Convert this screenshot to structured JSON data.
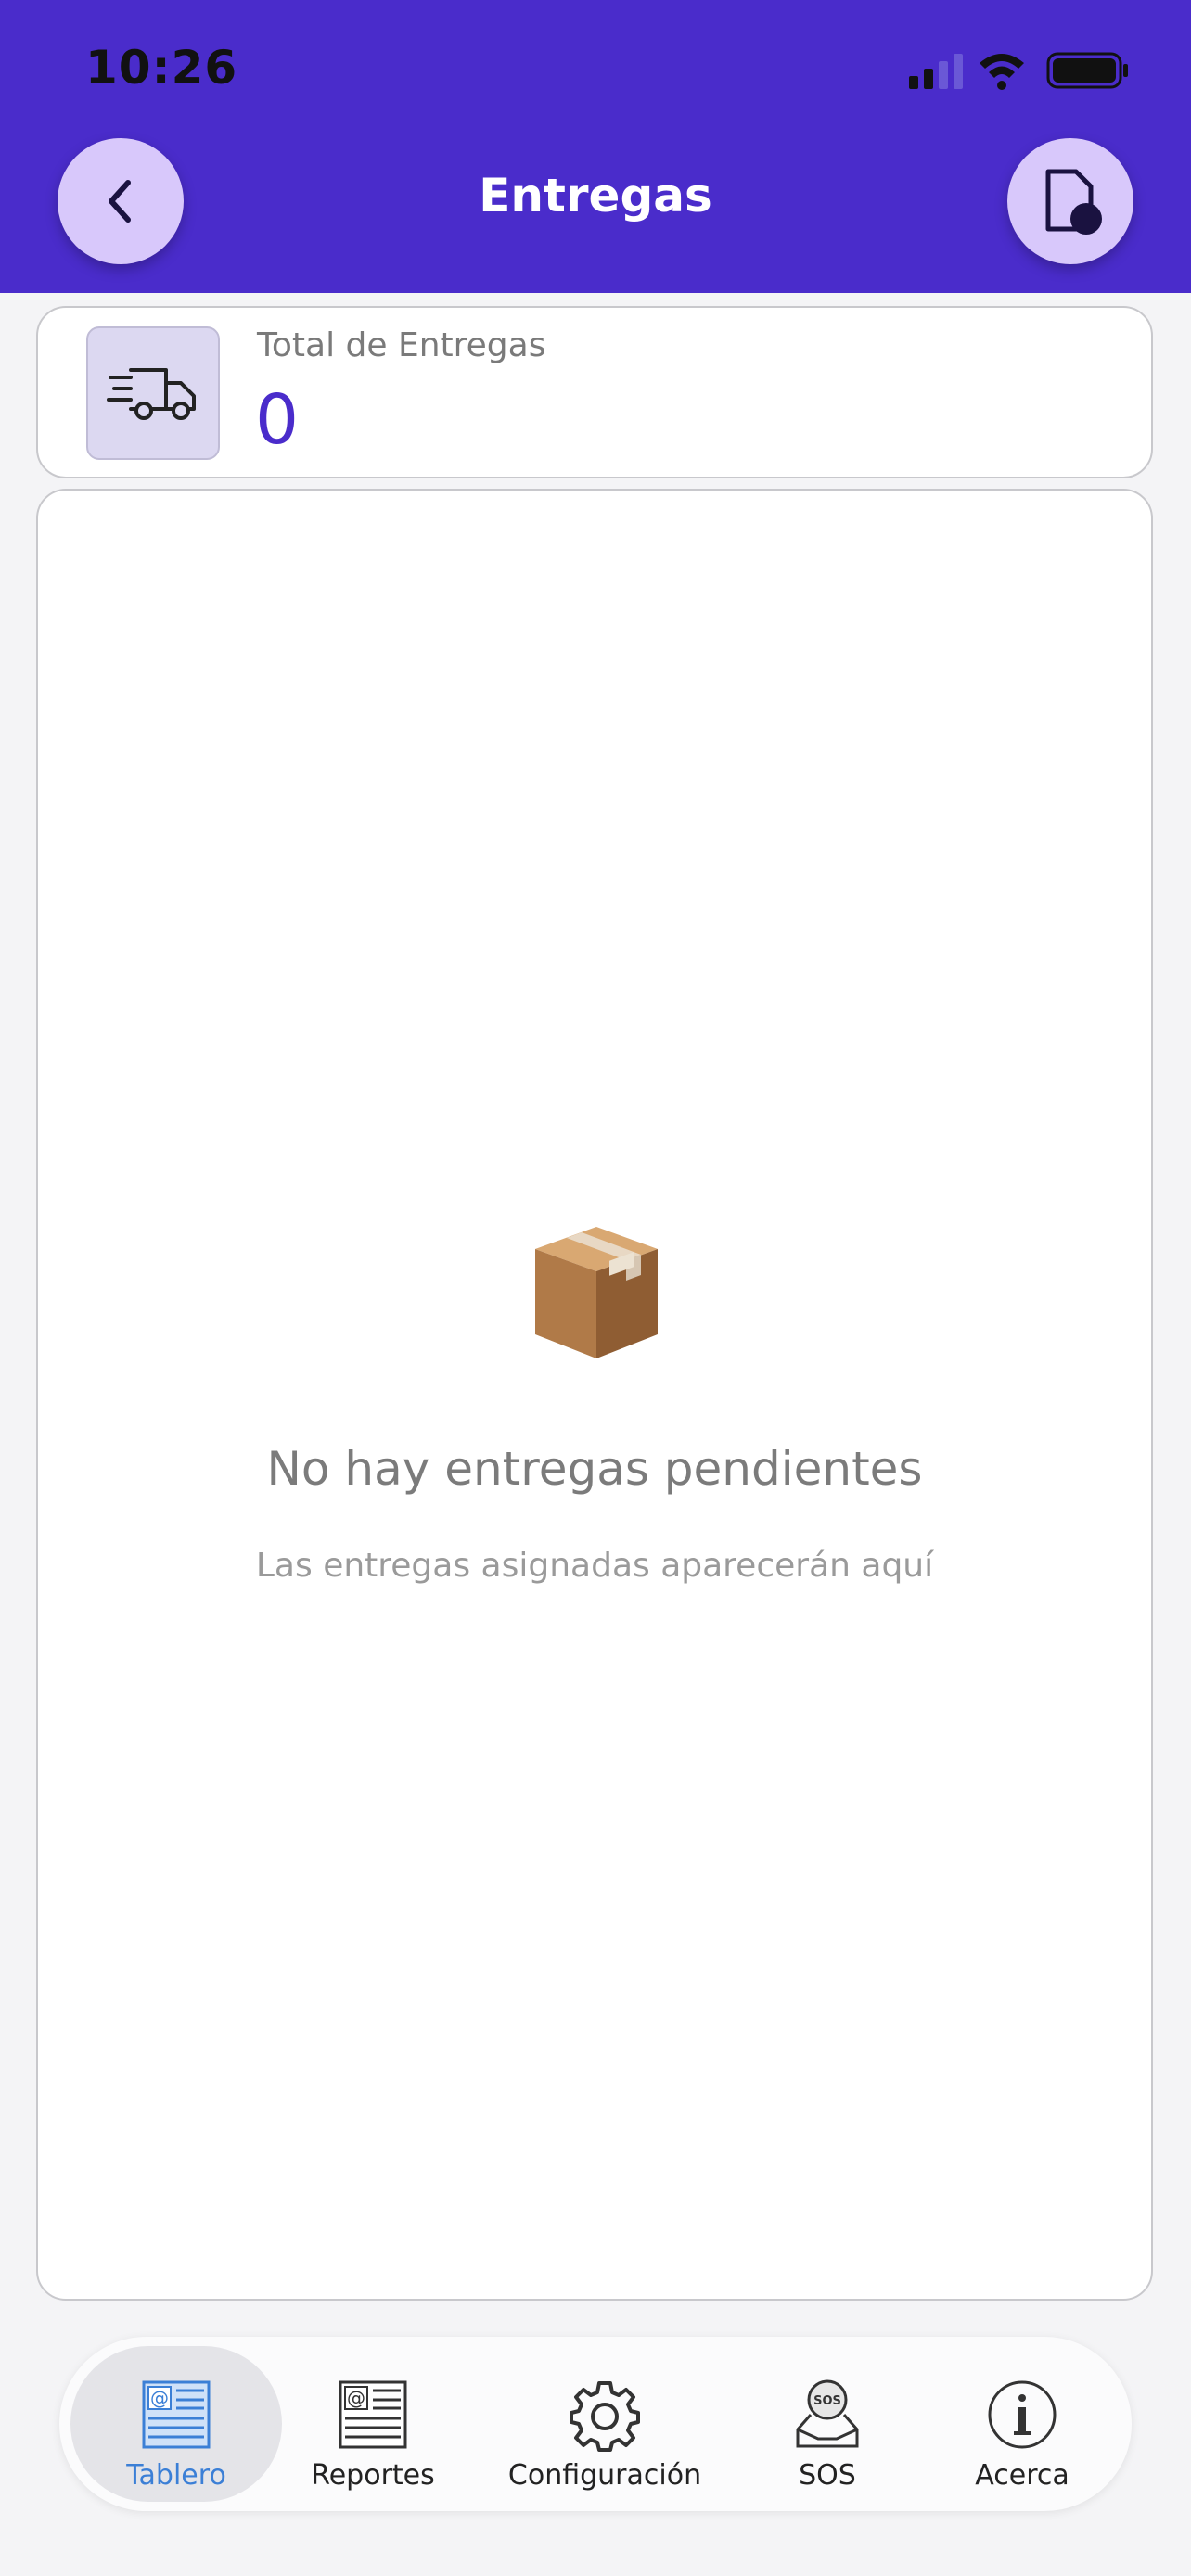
{
  "status_bar": {
    "time": "10:26"
  },
  "header": {
    "title": "Entregas",
    "back_icon": "chevron-left-icon",
    "action_icon": "document-record-icon",
    "background_color": "#4a2ccb",
    "button_color": "#d8c8fb"
  },
  "summary": {
    "label": "Total de Entregas",
    "value": "0",
    "icon": "delivery-truck-icon",
    "accent_color": "#4a2ccb"
  },
  "empty_state": {
    "icon": "package-icon",
    "title": "No hay entregas pendientes",
    "subtitle": "Las entregas asignadas aparecerán aquí"
  },
  "tabbar": {
    "active_color": "#3b7fd6",
    "items": [
      {
        "label": "Tablero",
        "icon": "dashboard-icon",
        "active": true
      },
      {
        "label": "Reportes",
        "icon": "reports-icon",
        "active": false
      },
      {
        "label": "Configuración",
        "icon": "gear-icon",
        "active": false
      },
      {
        "label": "SOS",
        "icon": "sos-icon",
        "active": false
      },
      {
        "label": "Acerca",
        "icon": "info-icon",
        "active": false
      }
    ]
  }
}
